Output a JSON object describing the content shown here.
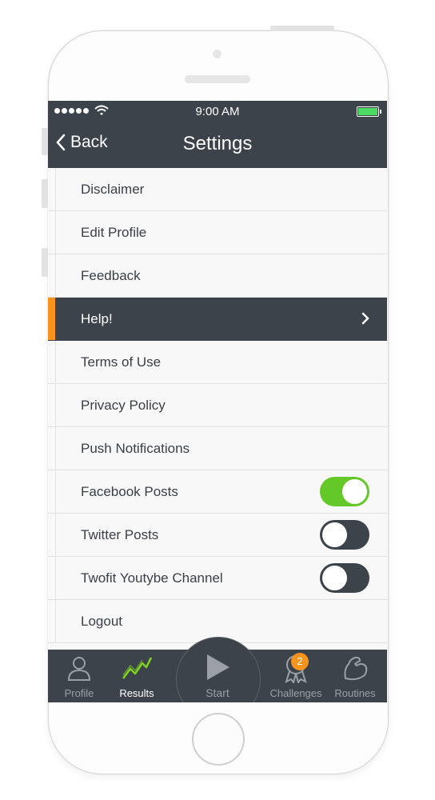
{
  "status_bar": {
    "time": "9:00 AM",
    "signal_dots": 5,
    "battery_color": "#4cd964"
  },
  "navbar": {
    "back_label": "Back",
    "title": "Settings"
  },
  "settings": {
    "items": [
      {
        "label": "Disclaimer"
      },
      {
        "label": "Edit Profile"
      },
      {
        "label": "Feedback"
      },
      {
        "label": "Help!",
        "selected": true
      },
      {
        "label": "Terms of Use"
      },
      {
        "label": "Privacy Policy"
      },
      {
        "label": "Push Notifications"
      },
      {
        "label": "Facebook Posts",
        "toggle": true,
        "enabled": true
      },
      {
        "label": "Twitter Posts",
        "toggle": true,
        "enabled": false
      },
      {
        "label": "Twofit Youtybe Channel",
        "toggle": true,
        "enabled": false
      },
      {
        "label": "Logout"
      }
    ]
  },
  "tabbar": {
    "profile": "Profile",
    "results": "Results",
    "start": "Start",
    "challenges": "Challenges",
    "challenges_badge": "2",
    "routines": "Routines",
    "selected_tab": "Results"
  },
  "colors": {
    "dark": "#3d434a",
    "accent": "#f7941d",
    "toggle_on": "#64c828",
    "results_icon": "#7ed321"
  }
}
